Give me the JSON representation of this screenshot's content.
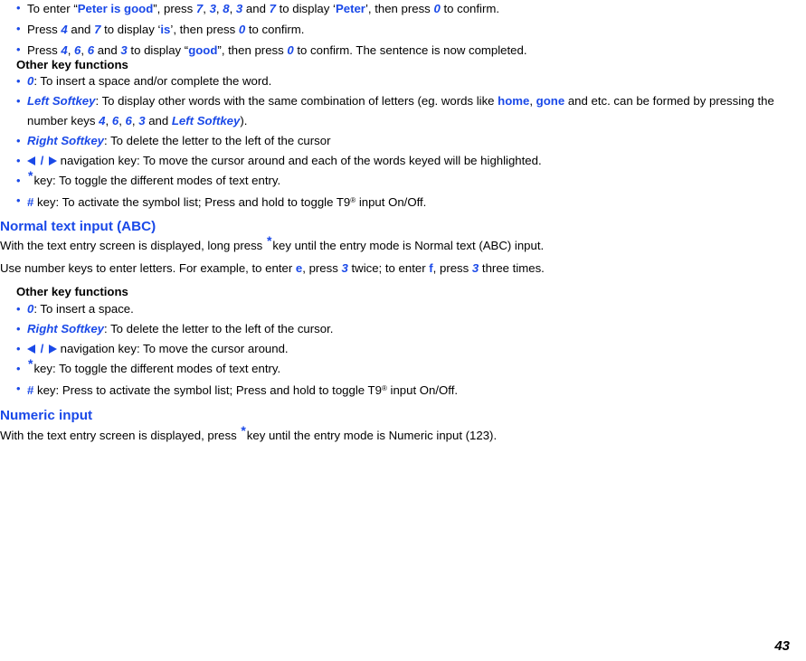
{
  "page": {
    "number": "43",
    "accent_color": "#1a49e8",
    "text_color": "#000000",
    "background": "#ffffff"
  },
  "t9_steps": {
    "items": [
      {
        "parts": [
          {
            "t": "To enter “",
            "s": "plain"
          },
          {
            "t": "Peter is good",
            "s": "blue-bold"
          },
          {
            "t": "”, press ",
            "s": "plain"
          },
          {
            "t": "7",
            "s": "blue-bold-italic"
          },
          {
            "t": ", ",
            "s": "plain"
          },
          {
            "t": "3",
            "s": "blue-bold-italic"
          },
          {
            "t": ", ",
            "s": "plain"
          },
          {
            "t": "8",
            "s": "blue-bold-italic"
          },
          {
            "t": ", ",
            "s": "plain"
          },
          {
            "t": "3",
            "s": "blue-bold-italic"
          },
          {
            "t": " and ",
            "s": "plain"
          },
          {
            "t": "7",
            "s": "blue-bold-italic"
          },
          {
            "t": " to display ‘",
            "s": "plain"
          },
          {
            "t": "Peter",
            "s": "blue-bold"
          },
          {
            "t": "’, then press ",
            "s": "plain"
          },
          {
            "t": "0",
            "s": "blue-bold-italic"
          },
          {
            "t": "  to confirm.",
            "s": "plain"
          }
        ]
      },
      {
        "parts": [
          {
            "t": "Press ",
            "s": "plain"
          },
          {
            "t": "4",
            "s": "blue-bold-italic"
          },
          {
            "t": "  and ",
            "s": "plain"
          },
          {
            "t": "7",
            "s": "blue-bold-italic"
          },
          {
            "t": "  to display ‘",
            "s": "plain"
          },
          {
            "t": "is",
            "s": "blue-bold"
          },
          {
            "t": "’, then press ",
            "s": "plain"
          },
          {
            "t": "0",
            "s": "blue-bold-italic"
          },
          {
            "t": "  to confirm.",
            "s": "plain"
          }
        ]
      },
      {
        "parts": [
          {
            "t": "Press ",
            "s": "plain"
          },
          {
            "t": "4",
            "s": "blue-bold-italic"
          },
          {
            "t": ", ",
            "s": "plain"
          },
          {
            "t": "6",
            "s": "blue-bold-italic"
          },
          {
            "t": ", ",
            "s": "plain"
          },
          {
            "t": "6",
            "s": "blue-bold-italic"
          },
          {
            "t": " and ",
            "s": "plain"
          },
          {
            "t": "3",
            "s": "blue-bold-italic"
          },
          {
            "t": "  to display “",
            "s": "plain"
          },
          {
            "t": "good",
            "s": "blue-bold"
          },
          {
            "t": "”, then press ",
            "s": "plain"
          },
          {
            "t": "0",
            "s": "blue-bold-italic"
          },
          {
            "t": " to confirm. The sentence is now completed.",
            "s": "plain"
          }
        ]
      }
    ]
  },
  "other_key_functions_1": {
    "heading": "Other key functions",
    "items": [
      {
        "parts": [
          {
            "t": "0",
            "s": "blue-bold-italic"
          },
          {
            "t": ": To insert a space and/or complete the word.",
            "s": "plain"
          }
        ]
      },
      {
        "parts": [
          {
            "t": "Left Softkey",
            "s": "blue-bold-italic"
          },
          {
            "t": ": To display other words with the same combination of letters (eg. words like ",
            "s": "plain"
          },
          {
            "t": "home",
            "s": "blue-bold"
          },
          {
            "t": ", ",
            "s": "plain"
          },
          {
            "t": "gone",
            "s": "blue-bold"
          },
          {
            "t": " and etc. can be formed by pressing the number keys ",
            "s": "plain"
          },
          {
            "t": "4",
            "s": "blue-bold-italic"
          },
          {
            "t": ", ",
            "s": "plain"
          },
          {
            "t": "6",
            "s": "blue-bold-italic"
          },
          {
            "t": ", ",
            "s": "plain"
          },
          {
            "t": "6",
            "s": "blue-bold-italic"
          },
          {
            "t": ", ",
            "s": "plain"
          },
          {
            "t": "3",
            "s": "blue-bold-italic"
          },
          {
            "t": " and ",
            "s": "plain"
          },
          {
            "t": "Left Softkey",
            "s": "blue-bold-italic"
          },
          {
            "t": ").",
            "s": "plain"
          }
        ]
      },
      {
        "parts": [
          {
            "t": "Right Softkey",
            "s": "blue-bold-italic"
          },
          {
            "t": ": To delete the letter to the left of the cursor",
            "s": "plain"
          }
        ]
      },
      {
        "parts": [
          {
            "t": "",
            "s": "arrow-left"
          },
          {
            "t": " / ",
            "s": "slash"
          },
          {
            "t": "",
            "s": "arrow-right"
          },
          {
            "t": " navigation key: To move the cursor around and each of the words keyed will be highlighted.",
            "s": "plain"
          }
        ]
      },
      {
        "parts": [
          {
            "t": "*",
            "s": "star"
          },
          {
            "t": "key: To toggle the different modes of text entry.",
            "s": "plain"
          }
        ]
      },
      {
        "parts": [
          {
            "t": "#",
            "s": "hash"
          },
          {
            "t": " key: To activate the symbol list; Press and hold to toggle T9",
            "s": "plain"
          },
          {
            "t": "®",
            "s": "reg"
          },
          {
            "t": " input On/Off.",
            "s": "plain"
          }
        ]
      }
    ]
  },
  "normal_text_input": {
    "heading": "Normal text input (ABC)",
    "paragraph1": [
      {
        "t": "With the text entry screen is displayed, long press ",
        "s": "plain"
      },
      {
        "t": "*",
        "s": "star"
      },
      {
        "t": "key until the entry mode is Normal text (ABC) input.",
        "s": "plain"
      }
    ],
    "paragraph2": [
      {
        "t": "Use number keys to enter letters. For example, to enter ",
        "s": "plain"
      },
      {
        "t": "e",
        "s": "blue-bold"
      },
      {
        "t": ", press ",
        "s": "plain"
      },
      {
        "t": "3",
        "s": "blue-bold-italic"
      },
      {
        "t": "  twice; to enter ",
        "s": "plain"
      },
      {
        "t": "f",
        "s": "blue-bold"
      },
      {
        "t": ", press ",
        "s": "plain"
      },
      {
        "t": "3",
        "s": "blue-bold-italic"
      },
      {
        "t": "  three times.",
        "s": "plain"
      }
    ]
  },
  "other_key_functions_2": {
    "heading": "Other key functions",
    "items": [
      {
        "parts": [
          {
            "t": "0",
            "s": "blue-bold-italic"
          },
          {
            "t": ": To insert a space.",
            "s": "plain"
          }
        ]
      },
      {
        "parts": [
          {
            "t": "Right Softkey",
            "s": "blue-bold-italic"
          },
          {
            "t": ": To delete the letter to the left of the cursor.",
            "s": "plain"
          }
        ]
      },
      {
        "parts": [
          {
            "t": "",
            "s": "arrow-left"
          },
          {
            "t": " / ",
            "s": "slash"
          },
          {
            "t": "",
            "s": "arrow-right"
          },
          {
            "t": " navigation key: To move the cursor around.",
            "s": "plain"
          }
        ]
      },
      {
        "parts": [
          {
            "t": "*",
            "s": "star"
          },
          {
            "t": "key: To toggle the different modes of text entry.",
            "s": "plain"
          }
        ]
      },
      {
        "parts": [
          {
            "t": "#",
            "s": "hash"
          },
          {
            "t": " key: Press to activate the symbol list; Press and hold to toggle T9",
            "s": "plain"
          },
          {
            "t": "®",
            "s": "reg"
          },
          {
            "t": " input On/Off.",
            "s": "plain"
          }
        ]
      }
    ]
  },
  "numeric_input": {
    "heading": "Numeric input",
    "paragraph": [
      {
        "t": "With the text entry screen is displayed, press ",
        "s": "plain"
      },
      {
        "t": "*",
        "s": "star"
      },
      {
        "t": "key until the entry mode is Numeric input (123).",
        "s": "plain"
      }
    ]
  }
}
